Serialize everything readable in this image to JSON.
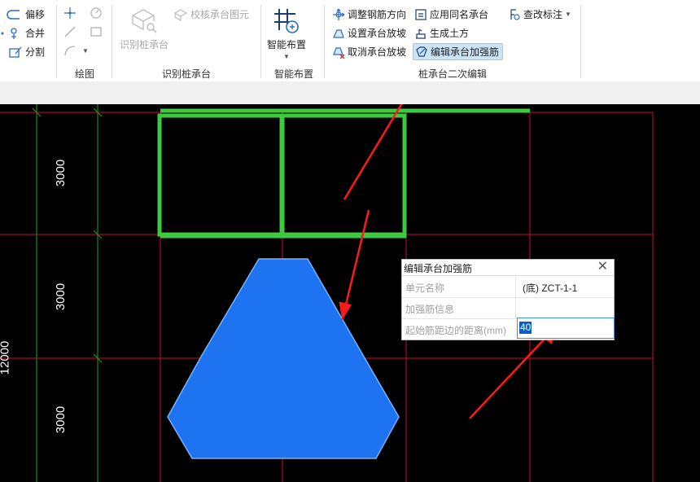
{
  "ribbon": {
    "draw_tools": {
      "offset": "偏移",
      "merge": "合并",
      "split": "分割"
    },
    "group_labels": {
      "draw": "绘图",
      "recognize": "识别桩承台",
      "smart": "智能布置",
      "secondary_edit": "桩承台二次编辑"
    },
    "recognize": {
      "recognize_cap": "识别桩承台",
      "check_cap": "校核承台图元"
    },
    "smart": {
      "smart_layout": "智能布置"
    },
    "edit": {
      "adjust_rebar_direction": "调整钢筋方向",
      "set_cap_slope": "设置承台放坡",
      "cancel_cap_slope": "取消承台放坡",
      "apply_same_name_cap": "应用同名承台",
      "generate_earthwork": "生成土方",
      "edit_cap_reinforcement": "编辑承台加强筋",
      "view_edit_annotation": "查改标注"
    }
  },
  "canvas": {
    "dimension_total": "12000",
    "dimension_rows": [
      "3000",
      "3000",
      "3000"
    ],
    "colors": {
      "background": "#000000",
      "grid_red": "#c8102e",
      "grid_green": "#1fa51f",
      "cap_green": "#3ec93e",
      "cap_blue": "#1e74f0"
    }
  },
  "dialog": {
    "title": "编辑承台加强筋",
    "rows": [
      {
        "name": "单元名称",
        "value": "(底) ZCT-1-1"
      },
      {
        "name": "加强筋信息",
        "value": ""
      }
    ],
    "distance_label": "起始筋距边的距离(mm)",
    "distance_value": "40"
  }
}
